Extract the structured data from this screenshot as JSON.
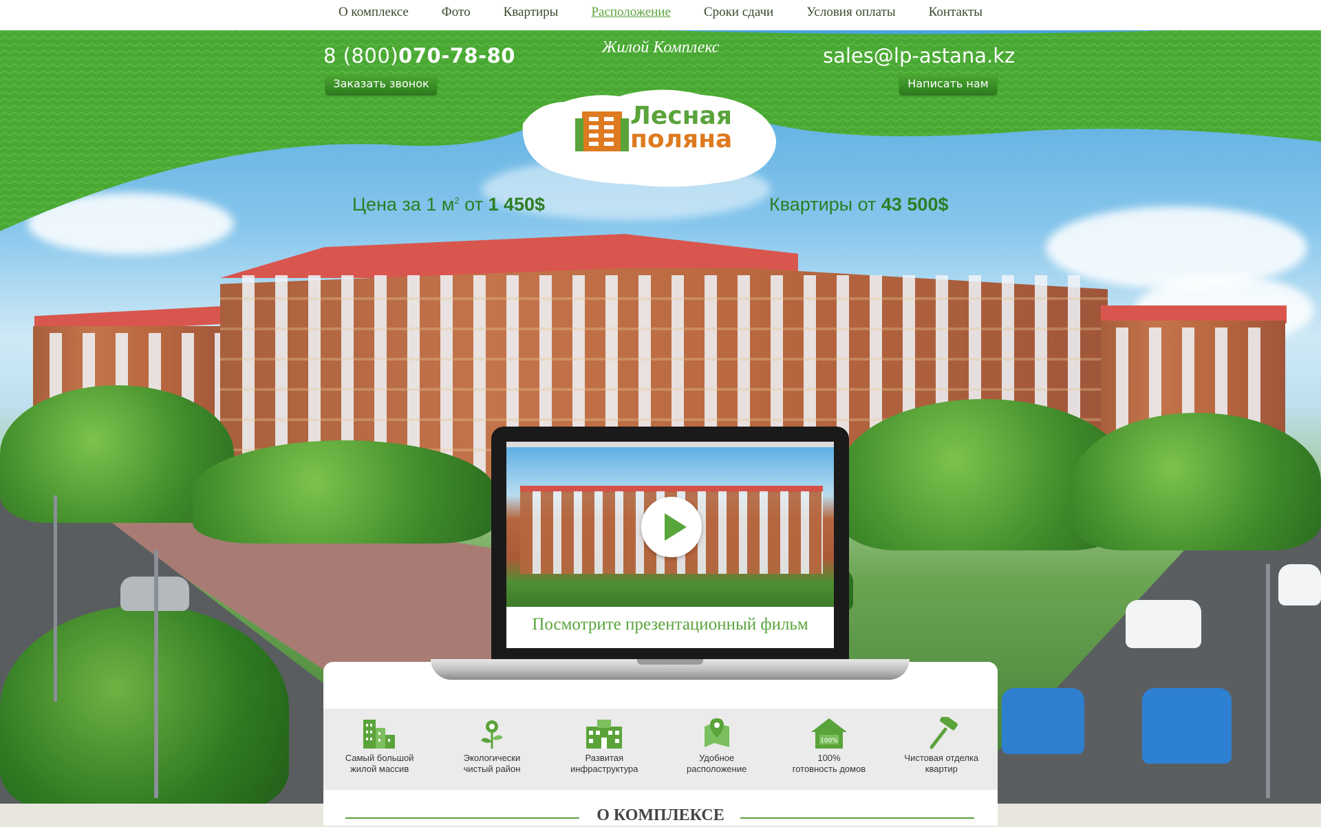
{
  "nav": {
    "items": [
      {
        "label": "О комплексе"
      },
      {
        "label": "Фото"
      },
      {
        "label": "Квартиры"
      },
      {
        "label": "Расположение",
        "active": true
      },
      {
        "label": "Сроки сдачи"
      },
      {
        "label": "Условия оплаты"
      },
      {
        "label": "Контакты"
      }
    ]
  },
  "header": {
    "phone_prefix": "8 (800)",
    "phone_number": "070-78-80",
    "call_button": "Заказать звонок",
    "tagline": "Жилой Комплекс",
    "email": "sales@lp-astana.kz",
    "write_button": "Написать нам"
  },
  "logo": {
    "line1": "Лесная",
    "line2": "поляна"
  },
  "prices": {
    "sqm_prefix": "Цена за 1 м",
    "sqm_sup": "2",
    "sqm_from": " от ",
    "sqm_value": "1 450$",
    "apt_prefix": "Квартиры от ",
    "apt_value": "43 500$"
  },
  "video": {
    "caption": "Посмотрите презентационный фильм"
  },
  "features": [
    {
      "icon": "buildings-icon",
      "line1": "Самый большой",
      "line2": "жилой массив"
    },
    {
      "icon": "flower-icon",
      "line1": "Экологически",
      "line2": "чистый район"
    },
    {
      "icon": "infrastructure-icon",
      "line1": "Развитая",
      "line2": "инфраструктура"
    },
    {
      "icon": "map-pin-icon",
      "line1": "Удобное",
      "line2": "расположение"
    },
    {
      "icon": "house-100-icon",
      "line1": "100%",
      "line2": "готовность домов",
      "badge": "100%"
    },
    {
      "icon": "paint-roller-icon",
      "line1": "Чистовая отделка",
      "line2": "квартир"
    }
  ],
  "section": {
    "title": "О КОМПЛЕКСЕ"
  },
  "colors": {
    "brand_green": "#5aa33b",
    "dark_green": "#2e7d24",
    "brand_orange": "#de7a1f",
    "roof_red": "#d8564d"
  }
}
